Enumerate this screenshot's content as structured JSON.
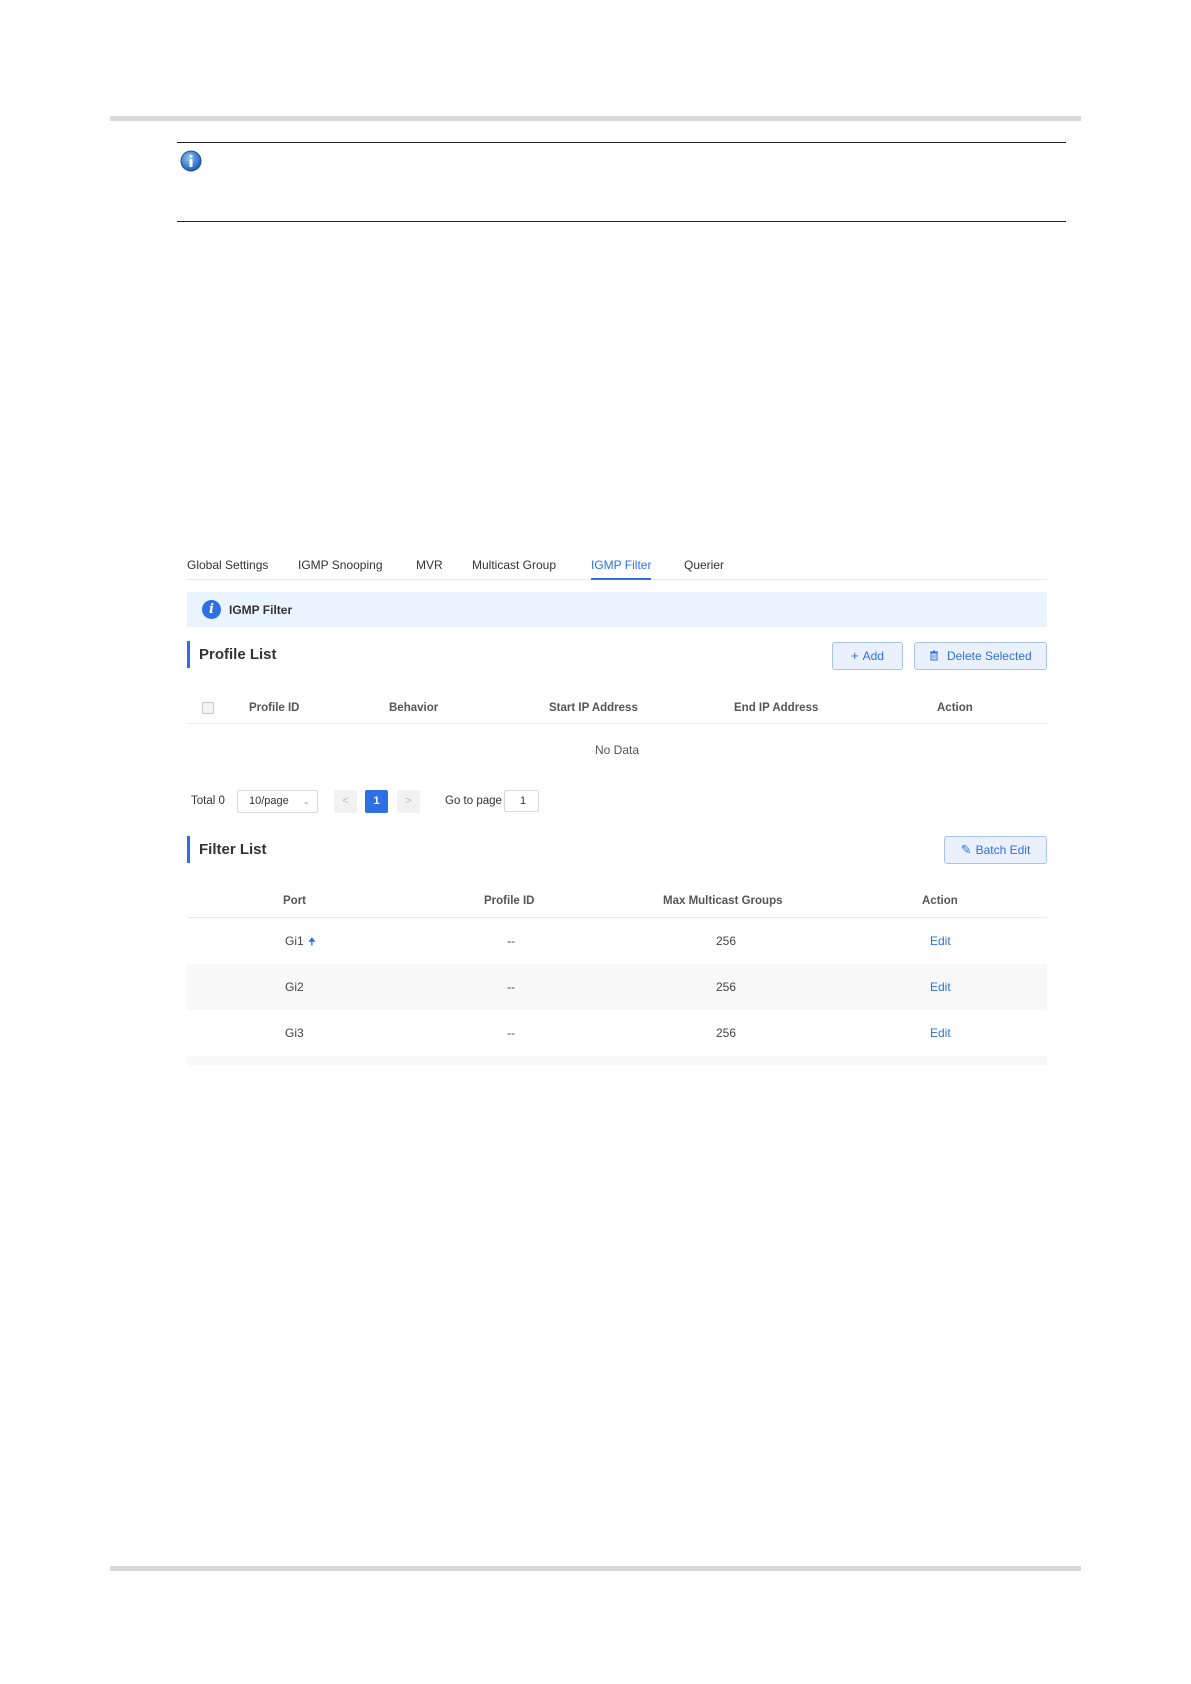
{
  "tabs": [
    {
      "label": "Global Settings",
      "active": false
    },
    {
      "label": "IGMP Snooping",
      "active": false
    },
    {
      "label": "MVR",
      "active": false
    },
    {
      "label": "Multicast Group",
      "active": false
    },
    {
      "label": "IGMP Filter",
      "active": true
    },
    {
      "label": "Querier",
      "active": false
    }
  ],
  "banner": {
    "icon": "info-icon",
    "text": "IGMP Filter"
  },
  "profile_list": {
    "title": "Profile List",
    "add_label": "Add",
    "delete_label": "Delete Selected",
    "columns": [
      "Profile ID",
      "Behavior",
      "Start IP Address",
      "End IP Address",
      "Action"
    ],
    "empty_text": "No Data"
  },
  "pagination": {
    "total_label": "Total 0",
    "page_size": "10/page",
    "current_page": "1",
    "goto_label": "Go to page",
    "goto_value": "1",
    "prev_glyph": "<",
    "next_glyph": ">"
  },
  "filter_list": {
    "title": "Filter List",
    "batch_edit_label": "Batch Edit",
    "columns": [
      "Port",
      "Profile ID",
      "Max Multicast Groups",
      "Action"
    ],
    "rows": [
      {
        "port": "Gi1",
        "uplink": true,
        "profile_id": "--",
        "max_groups": "256",
        "action": "Edit"
      },
      {
        "port": "Gi2",
        "uplink": false,
        "profile_id": "--",
        "max_groups": "256",
        "action": "Edit"
      },
      {
        "port": "Gi3",
        "uplink": false,
        "profile_id": "--",
        "max_groups": "256",
        "action": "Edit"
      }
    ]
  },
  "colors": {
    "accent": "#2f6fe4",
    "banner_bg": "#eaf4fe",
    "stripe": "#f8f8f8"
  }
}
